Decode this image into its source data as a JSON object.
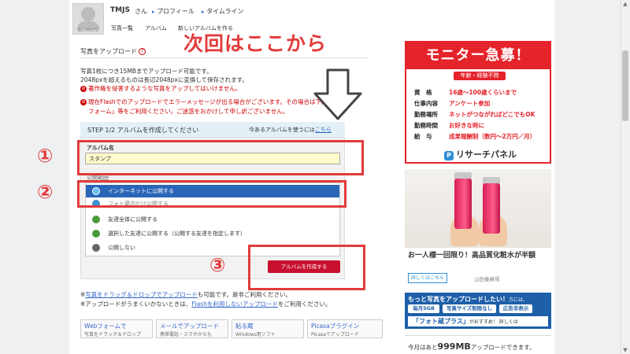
{
  "header": {
    "avatar_text": "NO PHOTO",
    "user_name": "TMJS",
    "user_suffix": "さん",
    "links": [
      "プロフィール",
      "タイムライン"
    ],
    "subnav": [
      "写真一覧",
      "アルバム",
      "新しいアルバムを作る"
    ]
  },
  "annotation": {
    "title": "次回はここから",
    "num1": "①",
    "num2": "②",
    "num3": "③",
    "accent_color": "#e23b3b"
  },
  "upload": {
    "section_title": "写真をアップロード",
    "help_icon": "?",
    "info_lines": [
      "写真1枚につき15MBまでアップロード可能です。",
      "2048pxを超えるものは長辺2048pxに変換して保存されます。"
    ],
    "warn_copyright": "著作権を侵害するような写真をアップしてはいけません。",
    "warn_flash": "現在Flashでのアップロードでエラーメッセージが出る場合がございます。その場合は下記の「WEB",
    "warn_flash_2": "フォーム」等をご利用ください。ご迷惑をおかけして申し訳ございません。",
    "step_label": "STEP 1/2  アルバムを作成してください",
    "step_right": "今あるアルバムを使うには",
    "step_right_link": "こちら",
    "album_name_label": "アルバム名",
    "album_name_value": "スタンプ",
    "publish_label": "公開範囲",
    "publish_options": [
      "インターネットに公開する",
      "フォト蔵内だけ公開する",
      "友達全体に公開する",
      "選択した友達に公開する（公開する友達を指定します）",
      "公開しない"
    ],
    "create_button": "アルバムを作成する",
    "foot_1_link": "写真をドラッグ＆ドロップでアップロード",
    "foot_1_rest": "も可能です。是非ご利用ください。",
    "foot_2_pre": "※アップロードがうまくいかないときは、",
    "foot_2_link": "Flashを利用しないアップロード",
    "foot_2_rest": "をご利用ください。",
    "methods": [
      {
        "title": "Webフォームで",
        "sub": "写真をドラッグ＆ドロップ"
      },
      {
        "title": "メールでアップロード",
        "sub": "携帯電話・スマホからも"
      },
      {
        "title": "貼る蔵",
        "sub": "Windows用ソフト"
      },
      {
        "title": "Picasaプラグイン",
        "sub": "Picasaでアップロード"
      }
    ]
  },
  "ads": {
    "close_icon": "i",
    "monitor": {
      "head": "モニター急募！",
      "sub": "年齢・経験不問",
      "rows": [
        {
          "k": "資　格",
          "v": "16歳～100歳くらいまで"
        },
        {
          "k": "仕事内容",
          "v": "アンケート参加"
        },
        {
          "k": "勤務場所",
          "v": "ネットがつながればどこでもOK"
        },
        {
          "k": "勤務時間",
          "v": "お好きな時に"
        },
        {
          "k": "給　与",
          "v": "成果報酬制（数円～2万円／月）"
        }
      ],
      "logo_mark": "P",
      "logo": "リサーチパネル"
    },
    "lotion": {
      "title": "お一人様一回限り！高品質化粧水が半額",
      "button": "詳しくはこちら",
      "source": "山田養蜂場"
    },
    "photozou": {
      "line1": "もっと写真をアップロードしたい！",
      "line1_suffix": "方には、",
      "pills": [
        "毎月5GB",
        "写真サイズ制限なし",
        "広告非表示"
      ],
      "banner": "「フォト蔵プラス」",
      "banner_suffix": "がおすすめ！ 詳しくは"
    }
  },
  "quota": {
    "pre": "今月はあと",
    "amount": "999MB",
    "post": "アップロードできます。"
  }
}
